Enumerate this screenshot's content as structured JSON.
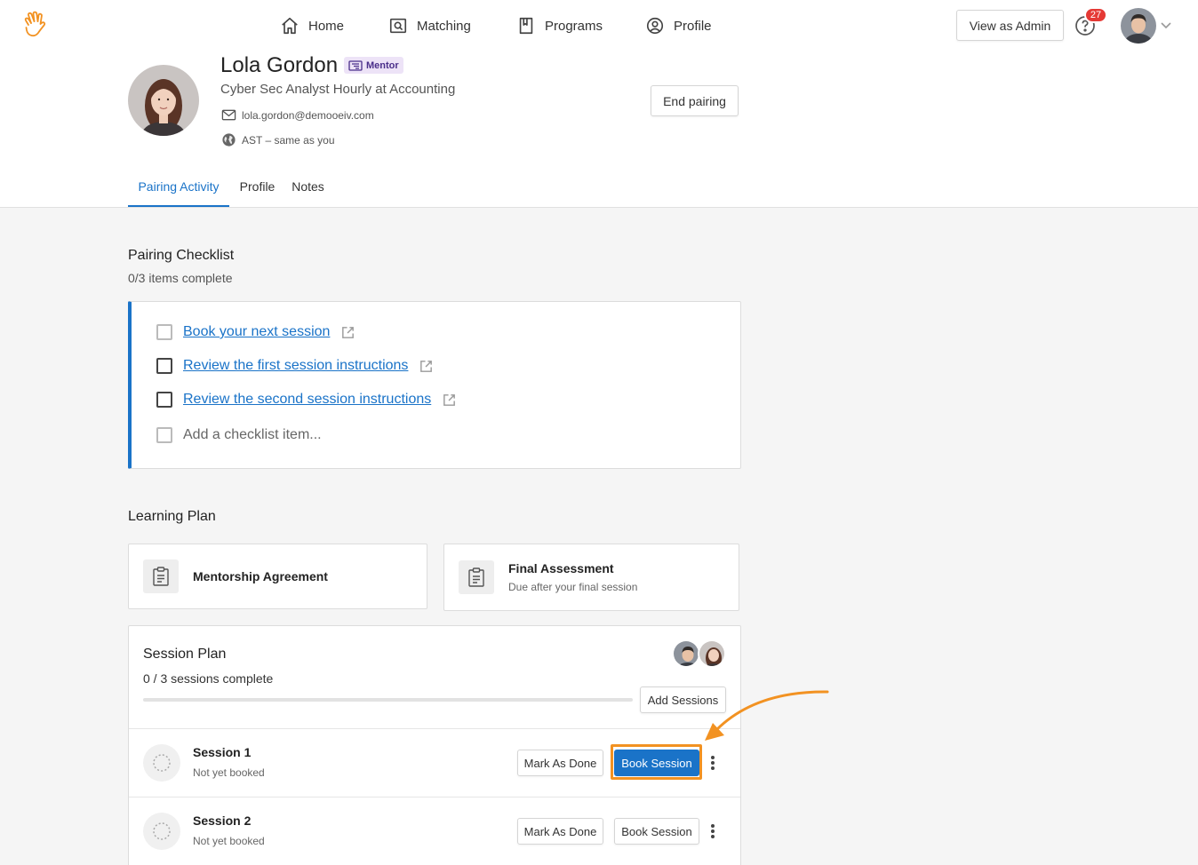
{
  "nav": {
    "home": "Home",
    "matching": "Matching",
    "programs": "Programs",
    "profile": "Profile",
    "view_as_admin": "View as Admin",
    "help_badge_count": "27"
  },
  "person": {
    "name": "Lola Gordon",
    "role_badge": "Mentor",
    "job_title": "Cyber Sec Analyst Hourly at Accounting",
    "email": "lola.gordon@demooeiv.com",
    "timezone": "AST – same as you",
    "end_pairing": "End pairing"
  },
  "tabs": [
    "Pairing Activity",
    "Profile",
    "Notes"
  ],
  "checklist": {
    "title": "Pairing Checklist",
    "progress_text": "0/3 items complete",
    "items": [
      "Book your next session",
      "Review the first session instructions",
      "Review the second session instructions"
    ],
    "add_placeholder": "Add a checklist item..."
  },
  "learning_plan": {
    "title": "Learning Plan",
    "cards": [
      {
        "title": "Mentorship Agreement",
        "subtitle": ""
      },
      {
        "title": "Final Assessment",
        "subtitle": "Due after your final session"
      }
    ]
  },
  "session_plan": {
    "title": "Session Plan",
    "progress_text": "0 / 3 sessions complete",
    "progress_fraction": 0,
    "add_sessions": "Add Sessions",
    "sessions": [
      {
        "title": "Session 1",
        "status": "Not yet booked",
        "mark_done": "Mark As Done",
        "book": "Book Session"
      },
      {
        "title": "Session 2",
        "status": "Not yet booked",
        "mark_done": "Mark As Done",
        "book": "Book Session"
      }
    ]
  },
  "colors": {
    "accent": "#1a73c8",
    "highlight": "#f29222",
    "badge": "#e53935"
  }
}
